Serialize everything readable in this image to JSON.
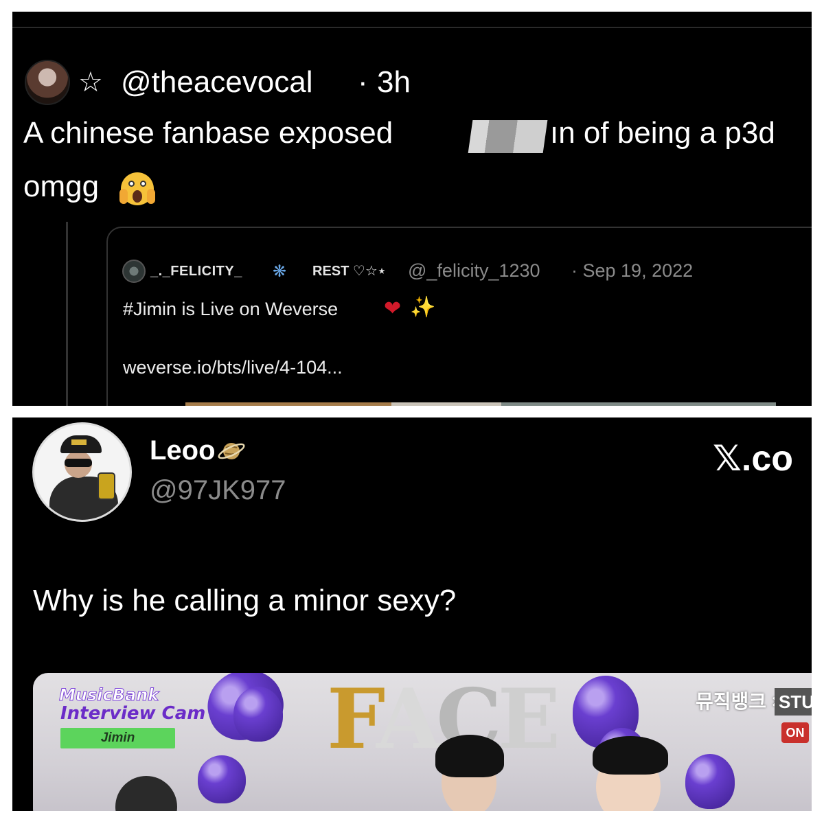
{
  "top_tweet": {
    "handle": "@theacevocal",
    "separator": "·",
    "time": "3h",
    "star": "☆",
    "text_line1_before": "A chinese fanbase exposed",
    "text_line1_after": "ın of being a p3d",
    "text_line2": "omgg",
    "emoji": "scream-emoji"
  },
  "quoted_tweet": {
    "name": "_._FELICITY_",
    "badge": "REST ♡☆⋆",
    "handle": "@_felicity_1230",
    "date": "· Sep 19, 2022",
    "text": "#Jimin is Live on Weverse",
    "heart": "❤",
    "sparkle": "✨",
    "link": "weverse.io/bts/live/4-104..."
  },
  "bottom_tweet": {
    "name": "Leoo",
    "handle": "@97JK977",
    "site_logo": "𝕏.co",
    "text": "Why is he calling a minor sexy?"
  },
  "video_overlay": {
    "show_logo": "MusicBank",
    "show_subtitle": "Interview Cam",
    "name_tag": "Jimin",
    "balloon_letters": [
      "F",
      "A",
      "C",
      "E"
    ],
    "korean_logo": "뮤직뱅크 ×",
    "studio_logo": "STUDIO",
    "on_badge": "ON"
  },
  "colors": {
    "background": "#000000",
    "text_primary": "#ffffff",
    "text_secondary": "#8b8b8b",
    "border": "#333333",
    "heart": "#d11a2a",
    "name_tag_bg": "#5cd45c",
    "balloon_purple": "#6a3fd0"
  }
}
